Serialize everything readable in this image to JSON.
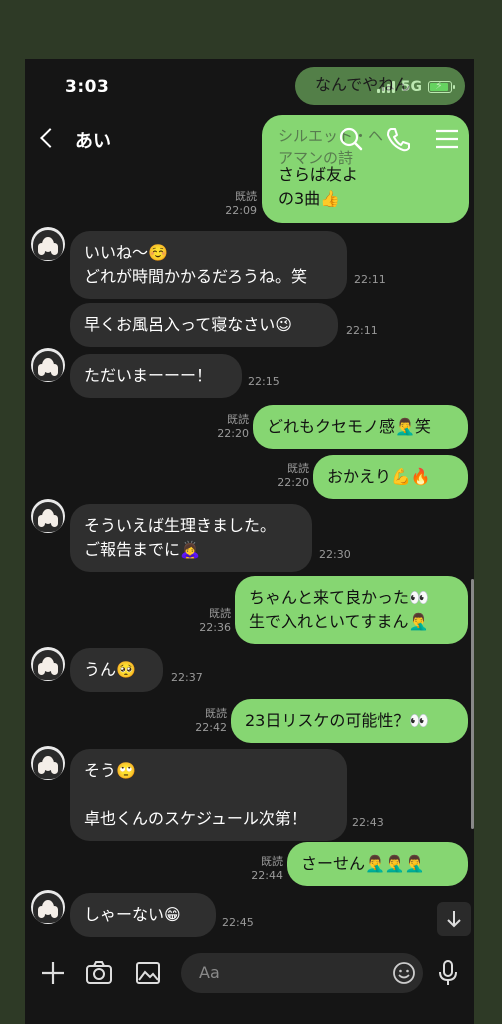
{
  "status": {
    "time": "3:03",
    "network": "5G"
  },
  "header": {
    "title": "あい"
  },
  "ghost": {
    "top_bubble": "なんでやねん",
    "overlap_text": "シルエット・ヘアマンの詩"
  },
  "messages": [
    {
      "dir": "out",
      "text": "さらば友よ\nの3曲👍",
      "read": "既読",
      "time": "22:09"
    },
    {
      "dir": "in",
      "text": "いいね〜☺️\nどれが時間かかるだろうね。笑",
      "time": "22:11"
    },
    {
      "dir": "in",
      "text": "早くお風呂入って寝なさい😉",
      "time": "22:11"
    },
    {
      "dir": "in",
      "text": "ただいまーーー！",
      "time": "22:15"
    },
    {
      "dir": "out",
      "text": "どれもクセモノ感🤦‍♂️笑",
      "read": "既読",
      "time": "22:20"
    },
    {
      "dir": "out",
      "text": "おかえり💪🔥",
      "read": "既読",
      "time": "22:20"
    },
    {
      "dir": "in",
      "text": "そういえば生理きました。\nご報告までに🙇‍♀️",
      "time": "22:30"
    },
    {
      "dir": "out",
      "text": "ちゃんと来て良かった👀\n生で入れといてすまん🤦‍♂️",
      "read": "既読",
      "time": "22:36"
    },
    {
      "dir": "in",
      "text": "うん🥺",
      "time": "22:37"
    },
    {
      "dir": "out",
      "text": "23日リスケの可能性？👀",
      "read": "既読",
      "time": "22:42"
    },
    {
      "dir": "in",
      "text": "そう🙄\n\n卓也くんのスケジュール次第！",
      "time": "22:43"
    },
    {
      "dir": "out",
      "text": "さーせん🤦‍♂️🤦‍♂️🤦‍♂️",
      "read": "既読",
      "time": "22:44"
    },
    {
      "dir": "in",
      "text": "しゃーない😁",
      "time": "22:45"
    }
  ],
  "input": {
    "placeholder": "Aa"
  },
  "icons": {
    "back": "chevron-left-icon",
    "search": "search-icon",
    "call": "phone-icon",
    "menu": "menu-icon",
    "add": "plus-icon",
    "camera": "camera-icon",
    "image": "image-icon",
    "emoji": "emoji-icon",
    "mic": "mic-icon",
    "scroll": "arrow-down-icon"
  },
  "colors": {
    "outgoing": "#86d672",
    "incoming": "#2f2f2f",
    "background": "#151515",
    "frame": "#2e3a26"
  }
}
